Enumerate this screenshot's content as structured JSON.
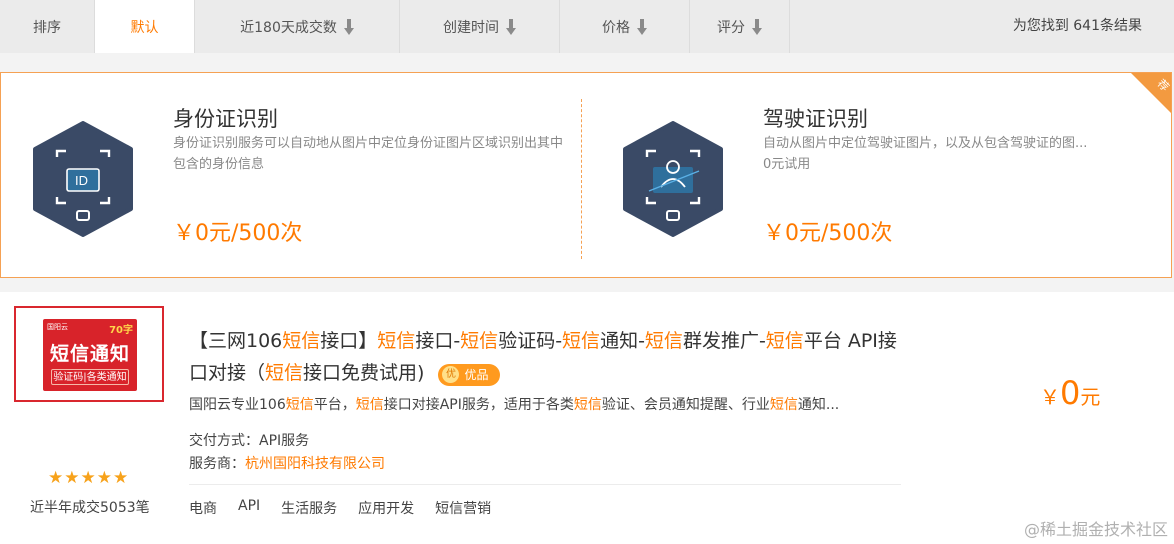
{
  "sortbar": {
    "label": "排序",
    "items": [
      "默认",
      "近180天成交数",
      "创建时间",
      "价格",
      "评分"
    ],
    "result_count": "为您找到 641条结果"
  },
  "recommend": {
    "corner_label": "荐",
    "cards": [
      {
        "title": "身份证识别",
        "desc": "身份证识别服务可以自动地从图片中定位身份证图片区域识别出其中包含的身份信息",
        "price": "￥0元/500次",
        "icon": "id-card-scan-icon"
      },
      {
        "title": "驾驶证识别",
        "desc": "自动从图片中定位驾驶证图片，以及从包含驾驶证的图...",
        "desc2": "0元试用",
        "price": "￥0元/500次",
        "icon": "driver-license-scan-icon"
      }
    ]
  },
  "product": {
    "thumb": {
      "top_text": "国阳云",
      "badge": "70字",
      "main": "短信通知",
      "sub": "验证码|各类通知"
    },
    "stars": "★★★★★",
    "deal_count": "近半年成交5053笔",
    "title_parts": [
      "【三网106",
      "短信",
      "接口】",
      "短信",
      "接口-",
      "短信",
      "验证码-",
      "短信",
      "通知-",
      "短信",
      "群发推广-",
      "短信",
      "平台 API接口对接（",
      "短信",
      "接口免费试用)"
    ],
    "badge_coin": "优",
    "badge_label": "优品",
    "desc_parts": [
      "国阳云专业106",
      "短信",
      "平台，",
      "短信",
      "接口对接API服务，适用于各类",
      "短信",
      "验证、会员通知提醒、行业",
      "短信",
      "通知..."
    ],
    "delivery_label": "交付方式：",
    "delivery_value": "API服务",
    "provider_label": "服务商：",
    "provider_value": "杭州国阳科技有限公司",
    "tags": [
      "电商",
      "API",
      "生活服务",
      "应用开发",
      "短信营销"
    ],
    "price_symbol": "￥",
    "price_value": "0",
    "price_unit": "元"
  },
  "watermark": "@稀土掘金技术社区"
}
